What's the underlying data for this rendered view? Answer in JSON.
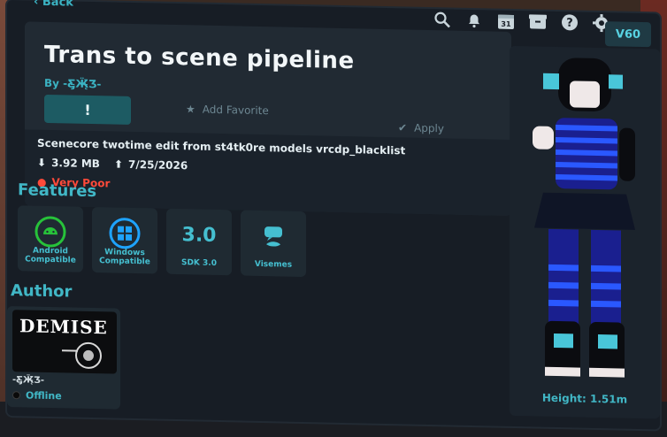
{
  "topbar": {
    "back_label": "Back",
    "icons": [
      "search-icon",
      "bell-icon",
      "calendar-icon",
      "inbox-icon",
      "help-icon",
      "gear-icon"
    ],
    "calendar_day": "31",
    "credits": "60"
  },
  "avatar": {
    "title": "Trans to scene pipeline",
    "by_prefix": "By",
    "author": "-Ƹ̵̡Ӝ̵̨̄Ʒ-",
    "report_label": "!",
    "favorite_label": "Add Favorite",
    "apply_label": "Apply",
    "description": "Scenecore twotime edit from st4tk0re models vrcdp_blacklist",
    "file_size": "3.92 MB",
    "updated": "7/25/2026",
    "performance": "Very Poor"
  },
  "features": {
    "heading": "Features",
    "items": [
      {
        "name": "android",
        "label": "Android Compatible"
      },
      {
        "name": "windows",
        "label": "Windows Compatible"
      },
      {
        "name": "sdk",
        "big": "3.0",
        "label": "SDK 3.0"
      },
      {
        "name": "visemes",
        "label": "Visemes"
      }
    ]
  },
  "author_section": {
    "heading": "Author",
    "image_title": "DEMISE",
    "name": "-Ƹ̵̡Ӝ̵̨̄Ʒ-",
    "status": "Offline"
  },
  "preview": {
    "height_label": "Height: 1.51m"
  },
  "colors": {
    "accent": "#41b7c6",
    "panel": "#171d25",
    "danger": "#ff4a3a"
  }
}
